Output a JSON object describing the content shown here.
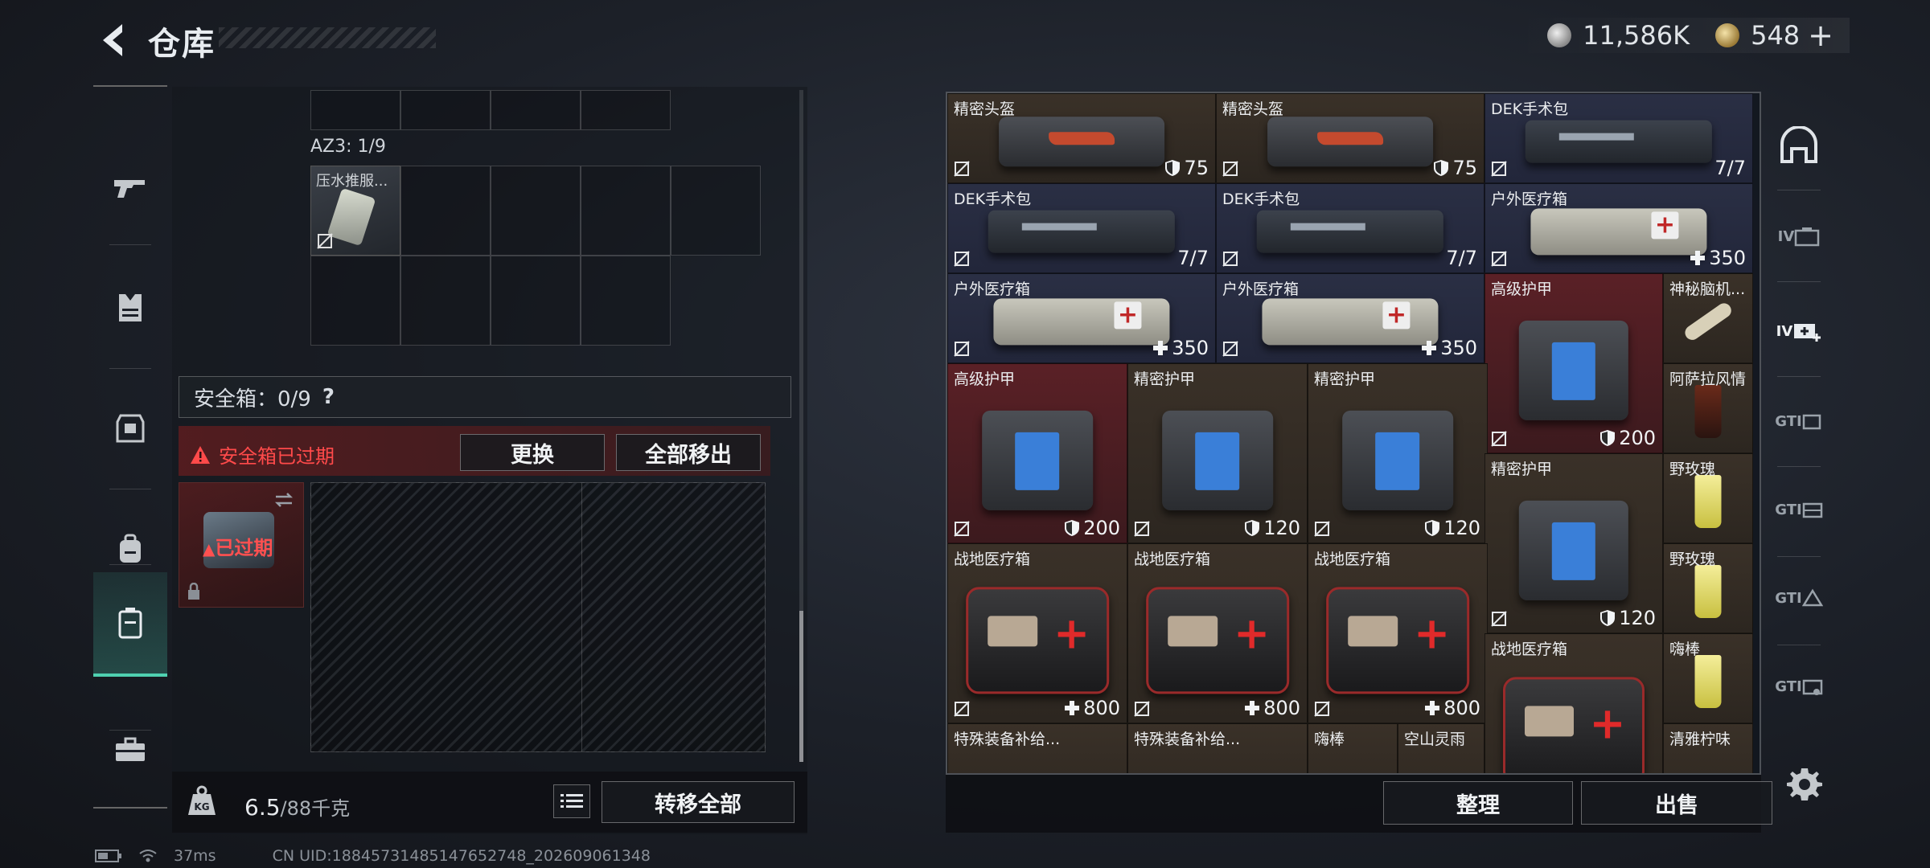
{
  "header": {
    "title": "仓库",
    "currency_silver": "11,586K",
    "currency_gold": "548",
    "gold_add": "+"
  },
  "left_nav": {
    "items": [
      {
        "name": "weapon"
      },
      {
        "name": "vest"
      },
      {
        "name": "armor"
      },
      {
        "name": "backpack"
      },
      {
        "name": "safebox",
        "active": true
      },
      {
        "name": "toolbox"
      }
    ]
  },
  "container": {
    "az3_label": "AZ3: 1/9",
    "az3_item_name": "压水推服...",
    "safebox_label": "安全箱：0/9",
    "safebox_help": "?",
    "expired_warning": "安全箱已过期",
    "replace_button": "更换",
    "move_all_button": "全部移出",
    "expired_tile_label": "已过期"
  },
  "footer_left": {
    "weight_current": "6.5",
    "weight_max": "/88千克",
    "transfer_all_button": "转移全部"
  },
  "status": {
    "ping": "37ms",
    "uid": "CN UID:18845731485147652748_202609061348"
  },
  "inventory": [
    {
      "name": "精密头盔",
      "value": "75",
      "badge": "shield",
      "color": "brown",
      "art": "bag redstripe"
    },
    {
      "name": "精密头盔",
      "value": "75",
      "badge": "shield",
      "color": "brown",
      "art": "bag redstripe"
    },
    {
      "name": "DEK手术包",
      "value": "7/7",
      "badge": "",
      "color": "blue",
      "art": "pouch"
    },
    {
      "name": "DEK手术包",
      "value": "7/7",
      "badge": "",
      "color": "blue",
      "art": "pouch"
    },
    {
      "name": "DEK手术包",
      "value": "7/7",
      "badge": "",
      "color": "blue",
      "art": "pouch"
    },
    {
      "name": "户外医疗箱",
      "value": "350",
      "badge": "plus",
      "color": "blue",
      "art": "medbox"
    },
    {
      "name": "户外医疗箱",
      "value": "350",
      "badge": "plus",
      "color": "blue",
      "art": "medbox"
    },
    {
      "name": "户外医疗箱",
      "value": "350",
      "badge": "plus",
      "color": "blue",
      "art": "medbox"
    },
    {
      "name": "高级护甲",
      "value": "200",
      "badge": "shield",
      "color": "red",
      "art": "bag blue"
    },
    {
      "name": "神秘脑机...",
      "value": "",
      "badge": "",
      "color": "brown",
      "art": "bone"
    },
    {
      "name": "阿萨拉风情",
      "value": "",
      "badge": "",
      "color": "brown",
      "art": "drink dark"
    },
    {
      "name": "高级护甲",
      "value": "200",
      "badge": "shield",
      "color": "red",
      "art": "bag blue"
    },
    {
      "name": "精密护甲",
      "value": "120",
      "badge": "shield",
      "color": "brown",
      "art": "bag blue"
    },
    {
      "name": "精密护甲",
      "value": "120",
      "badge": "shield",
      "color": "brown",
      "art": "bag blue"
    },
    {
      "name": "精密护甲",
      "value": "120",
      "badge": "shield",
      "color": "brown",
      "art": "bag blue"
    },
    {
      "name": "野玫瑰",
      "value": "",
      "badge": "",
      "color": "brown",
      "art": "drink"
    },
    {
      "name": "野玫瑰",
      "value": "",
      "badge": "",
      "color": "brown",
      "art": "drink"
    },
    {
      "name": "战地医疗箱",
      "value": "800",
      "badge": "plus",
      "color": "brown",
      "art": "firstaid"
    },
    {
      "name": "战地医疗箱",
      "value": "800",
      "badge": "plus",
      "color": "brown",
      "art": "firstaid"
    },
    {
      "name": "战地医疗箱",
      "value": "800",
      "badge": "plus",
      "color": "brown",
      "art": "firstaid"
    },
    {
      "name": "战地医疗箱",
      "value": "",
      "badge": "",
      "color": "brown",
      "art": "firstaid"
    },
    {
      "name": "嗨棒",
      "value": "",
      "badge": "",
      "color": "brown",
      "art": "drink"
    },
    {
      "name": "特殊装备补给...",
      "value": "",
      "badge": "",
      "color": "brown",
      "art": ""
    },
    {
      "name": "特殊装备补给...",
      "value": "",
      "badge": "",
      "color": "brown",
      "art": ""
    },
    {
      "name": "嗨棒",
      "value": "",
      "badge": "",
      "color": "brown",
      "art": ""
    },
    {
      "name": "空山灵雨",
      "value": "",
      "badge": "",
      "color": "brown",
      "art": ""
    },
    {
      "name": "清雅柠味",
      "value": "",
      "badge": "",
      "color": "brown",
      "art": ""
    }
  ],
  "right_bar": {
    "items": [
      {
        "name": "bunker",
        "label": ""
      },
      {
        "name": "tier-iv",
        "label": "IV"
      },
      {
        "name": "tier-iv-add",
        "label": "IV"
      },
      {
        "name": "gti-1",
        "label": "GTI"
      },
      {
        "name": "gti-2",
        "label": "GTI"
      },
      {
        "name": "gti-3",
        "label": "GTI"
      },
      {
        "name": "gti-4",
        "label": "GTI"
      }
    ]
  },
  "footer_right": {
    "organize_button": "整理",
    "sell_button": "出售"
  },
  "colors": {
    "accent": "#4fd0b0",
    "warning": "#ff4a4a",
    "cell_brown": "#3a3128",
    "cell_blue": "#2a2f44",
    "cell_red": "#5a2026"
  }
}
